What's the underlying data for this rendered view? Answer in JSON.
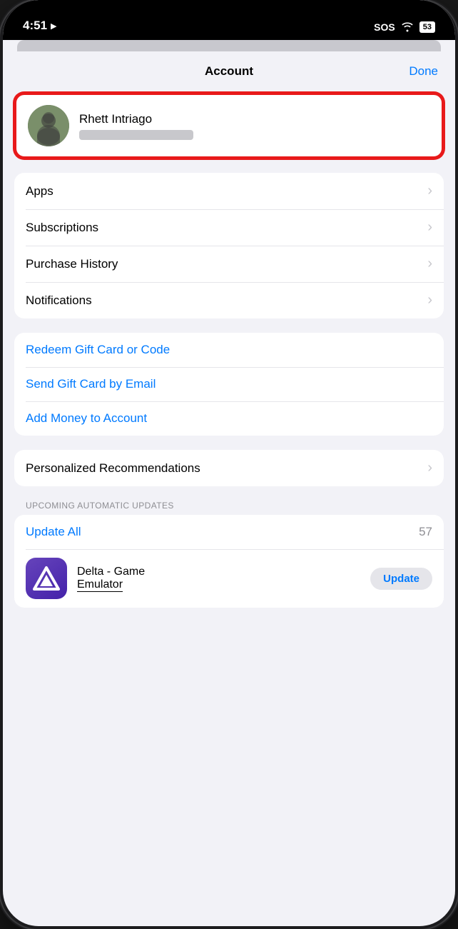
{
  "statusBar": {
    "time": "4:51",
    "locationIcon": "▶",
    "sos": "SOS",
    "batteryLevel": "53"
  },
  "header": {
    "title": "Account",
    "doneButton": "Done"
  },
  "profile": {
    "name": "Rhett Intriago",
    "emailBlurred": true
  },
  "menuGroup1": {
    "items": [
      {
        "label": "Apps",
        "hasChevron": true
      },
      {
        "label": "Subscriptions",
        "hasChevron": true
      },
      {
        "label": "Purchase History",
        "hasChevron": true
      },
      {
        "label": "Notifications",
        "hasChevron": true
      }
    ]
  },
  "menuGroup2": {
    "items": [
      {
        "label": "Redeem Gift Card or Code",
        "blue": true,
        "hasChevron": false
      },
      {
        "label": "Send Gift Card by Email",
        "blue": true,
        "hasChevron": false
      },
      {
        "label": "Add Money to Account",
        "blue": true,
        "hasChevron": false
      }
    ]
  },
  "menuGroup3": {
    "items": [
      {
        "label": "Personalized Recommendations",
        "hasChevron": true
      }
    ]
  },
  "upcomingUpdates": {
    "sectionLabel": "UPCOMING AUTOMATIC UPDATES",
    "updateAllLabel": "Update All",
    "updateAllCount": "57"
  },
  "appUpdate": {
    "name": "Delta - Game",
    "nameLine2": "Emulator",
    "updateButton": "Update"
  }
}
